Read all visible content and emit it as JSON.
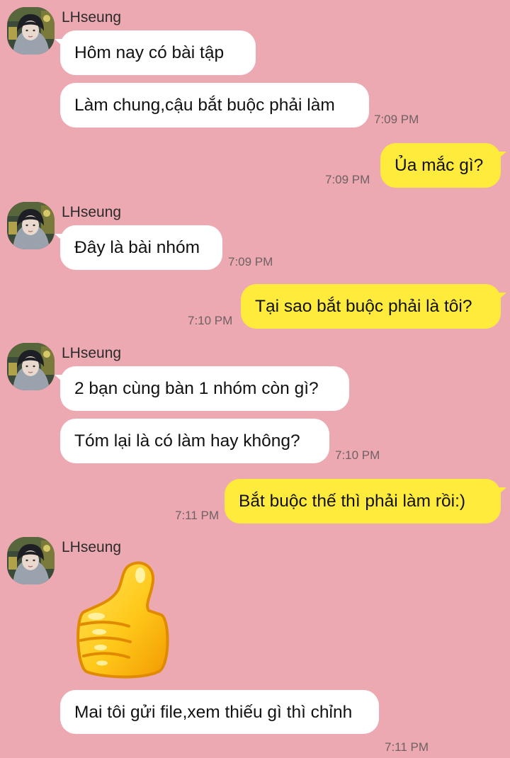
{
  "colors": {
    "background": "#EDA9B1",
    "incoming_bubble": "#FFFFFF",
    "outgoing_bubble": "#FFEB3B"
  },
  "messages": [
    {
      "sender": "LHseung",
      "direction": "incoming",
      "text": "Hôm nay có bài tập"
    },
    {
      "sender": "LHseung",
      "direction": "incoming",
      "text": "Làm chung,cậu bắt buộc phải làm",
      "time": "7:09 PM"
    },
    {
      "direction": "outgoing",
      "text": "Ủa mắc gì?",
      "time": "7:09 PM"
    },
    {
      "sender": "LHseung",
      "direction": "incoming",
      "text": "Đây là bài nhóm",
      "time": "7:09 PM"
    },
    {
      "direction": "outgoing",
      "text": "Tại sao bắt buộc phải là tôi?",
      "time": "7:10 PM"
    },
    {
      "sender": "LHseung",
      "direction": "incoming",
      "text": "2 bạn cùng bàn 1 nhóm còn gì?"
    },
    {
      "sender": "LHseung",
      "direction": "incoming",
      "text": "Tóm lại là có làm hay không?",
      "time": "7:10 PM"
    },
    {
      "direction": "outgoing",
      "text": "Bắt buộc thế thì phải làm rồi:)",
      "time": "7:11 PM"
    },
    {
      "sender": "LHseung",
      "direction": "incoming",
      "sticker": "thumbs-up-sticker"
    },
    {
      "sender": "LHseung",
      "direction": "incoming",
      "text": "Mai tôi gửi file,xem thiếu gì thì chỉnh",
      "time": "7:11 PM"
    }
  ]
}
